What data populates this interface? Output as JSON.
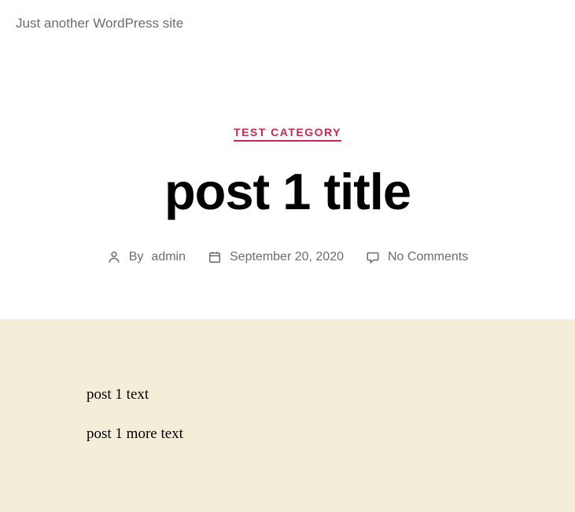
{
  "site": {
    "tagline": "Just another WordPress site"
  },
  "post": {
    "category": "TEST CATEGORY",
    "title": "post 1 title",
    "meta": {
      "by_label": "By ",
      "author": "admin",
      "date": "September 20, 2020",
      "comments": "No Comments"
    },
    "content": {
      "paragraphs": [
        "post 1 text",
        "post 1 more text"
      ]
    }
  }
}
